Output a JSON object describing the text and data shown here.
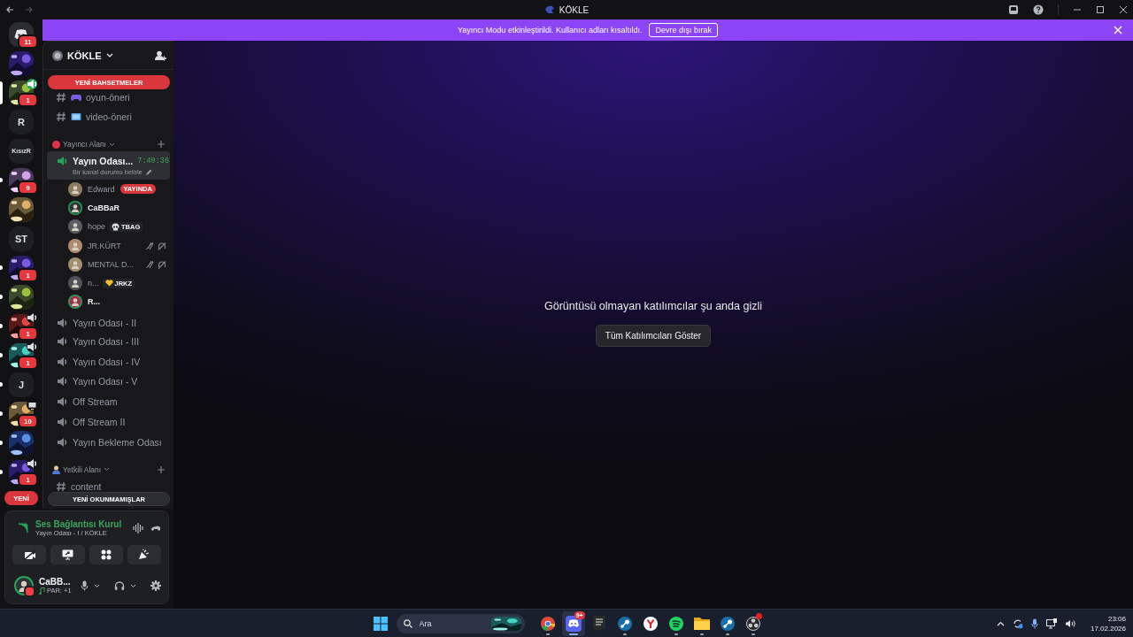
{
  "titlebar": {
    "title": "KÖKLE"
  },
  "banner": {
    "text": "Yayıncı Modu etkinleştirildi. Kullanıcı adları kısaltıldı.",
    "button": "Devre dışı bırak"
  },
  "servers": [
    {
      "kind": "home",
      "badge": "11",
      "selected": false,
      "unread": false
    },
    {
      "kind": "picture",
      "selected": false,
      "unread": false
    },
    {
      "kind": "picture",
      "badge": "1",
      "activity": {
        "kind": "voice"
      },
      "selected": true,
      "unread": false
    },
    {
      "kind": "letters",
      "text": "R",
      "selected": false,
      "unread": false
    },
    {
      "kind": "letters",
      "text": "KısızR",
      "selected": false,
      "unread": false
    },
    {
      "kind": "picture",
      "badge": "9",
      "selected": false,
      "unread": true
    },
    {
      "kind": "picture",
      "selected": false,
      "unread": false
    },
    {
      "kind": "letters",
      "text": "ST",
      "selected": false,
      "unread": false
    },
    {
      "kind": "picture",
      "badge": "1",
      "selected": false,
      "unread": true
    },
    {
      "kind": "picture",
      "selected": false,
      "unread": true
    },
    {
      "kind": "picture",
      "badge": "1",
      "activity": {
        "kind": "speaker"
      },
      "selected": false,
      "unread": true
    },
    {
      "kind": "picture",
      "badge": "1",
      "activity": {
        "kind": "speaker"
      },
      "selected": false,
      "unread": true
    },
    {
      "kind": "letters",
      "text": "J",
      "selected": false,
      "unread": true
    },
    {
      "kind": "picture",
      "badge": "10",
      "activity": {
        "kind": "screen"
      },
      "selected": false,
      "unread": true
    },
    {
      "kind": "picture",
      "selected": false,
      "unread": true
    },
    {
      "kind": "picture",
      "badge": "1",
      "activity": {
        "kind": "speaker"
      },
      "selected": false,
      "unread": true
    }
  ],
  "new_pill": "YENİ",
  "server": {
    "name": "KÖKLE"
  },
  "mention_pill": "YENİ BAHSETMELER",
  "unread_pill": "YENİ OKUNMAMIŞLAR",
  "channels": [
    {
      "kind": "text",
      "name": "oyun-öneri",
      "emoji": true
    },
    {
      "kind": "text",
      "name": "video-öneri",
      "emoji": true
    },
    {
      "kind": "category",
      "name": "Yayıncı Alanı"
    },
    {
      "kind": "voice",
      "name": "Yayın Odası...",
      "selected": true,
      "timer": "7:40:36",
      "status": "Bir kanal durumu belirle",
      "members": [
        {
          "name": "Edward",
          "speaking": false,
          "badge": "YAYINDA",
          "muted": false,
          "deafened": false
        },
        {
          "name": "CaBBaR",
          "speaking": true,
          "muted": false,
          "deafened": false
        },
        {
          "name": "hope",
          "speaking": false,
          "tag": {
            "kind": "skull",
            "text": "TBAG"
          },
          "muted": false,
          "deafened": false
        },
        {
          "name": "JR.KÜRT",
          "speaking": false,
          "muted": true,
          "deafened": true
        },
        {
          "name": "MENTAL D...",
          "speaking": false,
          "muted": true,
          "deafened": true
        },
        {
          "name": "n...",
          "speaking": false,
          "tag": {
            "kind": "heart",
            "text": "JRKZ"
          },
          "muted": false,
          "deafened": false
        },
        {
          "name": "R...",
          "speaking": true,
          "muted": false,
          "deafened": false
        }
      ]
    },
    {
      "kind": "voice",
      "name": "Yayın Odası - II",
      "selected": false
    },
    {
      "kind": "voice",
      "name": "Yayın Odası - III",
      "selected": false
    },
    {
      "kind": "voice",
      "name": "Yayın Odası - IV",
      "selected": false
    },
    {
      "kind": "voice",
      "name": "Yayın Odası - V",
      "selected": false
    },
    {
      "kind": "voice",
      "name": "Off Stream",
      "selected": false
    },
    {
      "kind": "voice",
      "name": "Off Stream II",
      "selected": false
    },
    {
      "kind": "voice",
      "name": "Yayın Bekleme Odası",
      "selected": false
    },
    {
      "kind": "category",
      "name": "Yetkili Alanı"
    },
    {
      "kind": "text",
      "name": "content",
      "emoji": false
    }
  ],
  "voice_panel": {
    "status": "Ses Bağlantısı Kurul",
    "location": "Yayın Odası - I / KÖKLE"
  },
  "user_panel": {
    "name": "CaBB...",
    "activity": "PAR: +1"
  },
  "stage": {
    "message": "Görüntüsü olmayan katılımcılar şu anda gizli",
    "button": "Tüm Katılımcıları Göster"
  },
  "taskbar": {
    "search_placeholder": "Ara",
    "apps": [
      {
        "kind": "chrome",
        "running": true,
        "selected": false,
        "alert": false
      },
      {
        "kind": "discord",
        "badge": "9+",
        "running": true,
        "selected": true,
        "alert": false
      },
      {
        "kind": "epic",
        "running": false,
        "selected": false,
        "alert": false
      },
      {
        "kind": "steam",
        "running": true,
        "selected": false,
        "alert": false
      },
      {
        "kind": "yandex",
        "running": false,
        "selected": false,
        "alert": false
      },
      {
        "kind": "spotify",
        "running": true,
        "selected": false,
        "alert": false
      },
      {
        "kind": "files",
        "running": true,
        "selected": false,
        "alert": false
      },
      {
        "kind": "steam",
        "running": true,
        "selected": false,
        "alert": false
      },
      {
        "kind": "obs",
        "running": true,
        "selected": false,
        "alert": true
      }
    ],
    "time": "23:06",
    "date": "17.02.2026"
  }
}
